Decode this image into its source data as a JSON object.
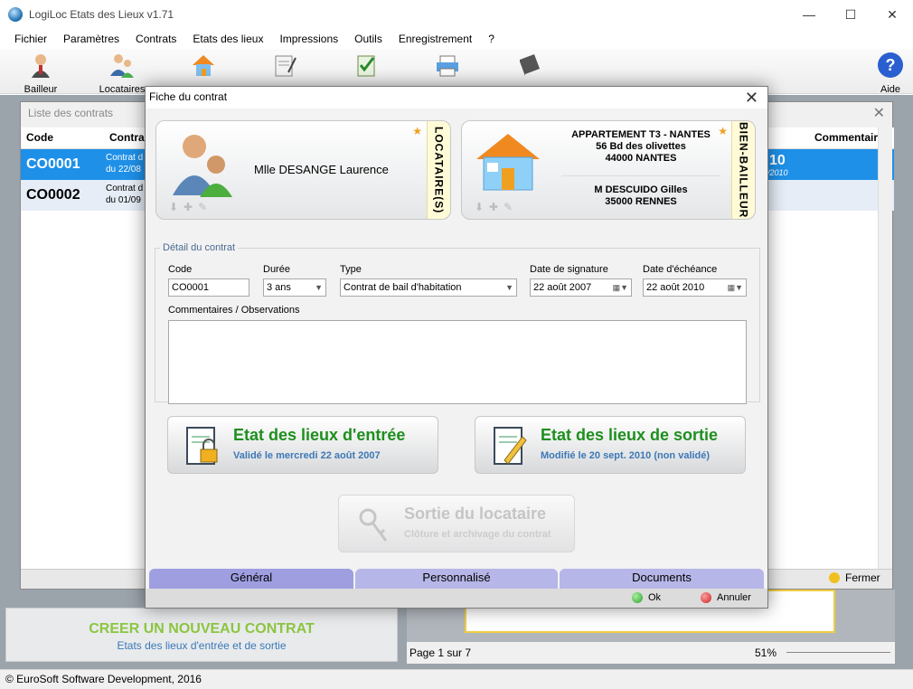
{
  "window": {
    "title": "LogiLoc Etats des Lieux v1.71",
    "minimize": "—",
    "maximize": "☐",
    "close": "✕"
  },
  "menu": [
    "Fichier",
    "Paramètres",
    "Contrats",
    "Etats des lieux",
    "Impressions",
    "Outils",
    "Enregistrement",
    "?"
  ],
  "toolbar": {
    "bailleur": "Bailleur",
    "locataires": "Locataires",
    "aide": "Aide"
  },
  "list": {
    "title": "Liste des contrats",
    "col_code": "Code",
    "col_contrat": "Contra",
    "col_commentaire": "Commentaire",
    "row1": {
      "code": "CO0001",
      "desc1": "Contrat d",
      "desc2": "du 22/08",
      "date": "10",
      "date2": "/2010"
    },
    "row2": {
      "code": "CO0002",
      "desc1": "Contrat d",
      "desc2": "du 01/09"
    }
  },
  "left_panel": {
    "title": "CREER UN NOUVEAU CONTRAT",
    "subtitle": "Etats des lieux d'entrée et de sortie"
  },
  "preview": {
    "page_label": "Page 1 sur 7",
    "zoom": "51%",
    "fermer": "Fermer"
  },
  "status": "© EuroSoft Software Development, 2016",
  "dialog": {
    "title": "Fiche du contrat",
    "locataire": {
      "name": "Mlle DESANGE Laurence",
      "label": "LOCATAIRE(S)"
    },
    "bien": {
      "line1": "APPARTEMENT T3 - NANTES",
      "line2": "56 Bd des olivettes",
      "line3": "44000 NANTES",
      "owner1": "M DESCUIDO Gilles",
      "owner2": "35000 RENNES",
      "label": "BIEN-BAILLEUR"
    },
    "detail": {
      "legend": "Détail du contrat",
      "code_label": "Code",
      "code_value": "CO0001",
      "duree_label": "Durée",
      "duree_value": "3 ans",
      "type_label": "Type",
      "type_value": "Contrat de bail d'habitation",
      "signature_label": "Date de signature",
      "signature_value": "22 août 2007",
      "echeance_label": "Date d'échéance",
      "echeance_value": "22 août 2010",
      "comments_label": "Commentaires / Observations",
      "comments_value": ""
    },
    "entree": {
      "title": "Etat des lieux d'entrée",
      "subtitle": "Validé le mercredi 22 août 2007"
    },
    "sortie": {
      "title": "Etat des lieux de sortie",
      "subtitle": "Modifié le 20 sept. 2010 (non validé)"
    },
    "sortie_locataire": {
      "title": "Sortie du locataire",
      "subtitle": "Clôture et archivage du contrat"
    },
    "tabs": [
      "Général",
      "Personnalisé",
      "Documents"
    ],
    "ok": "Ok",
    "annuler": "Annuler"
  },
  "colors": {
    "selected_row": "#1e90e8",
    "green_title": "#1e8f1e",
    "blue_sub": "#3c78b5",
    "tab_active": "#b6b6e8"
  }
}
